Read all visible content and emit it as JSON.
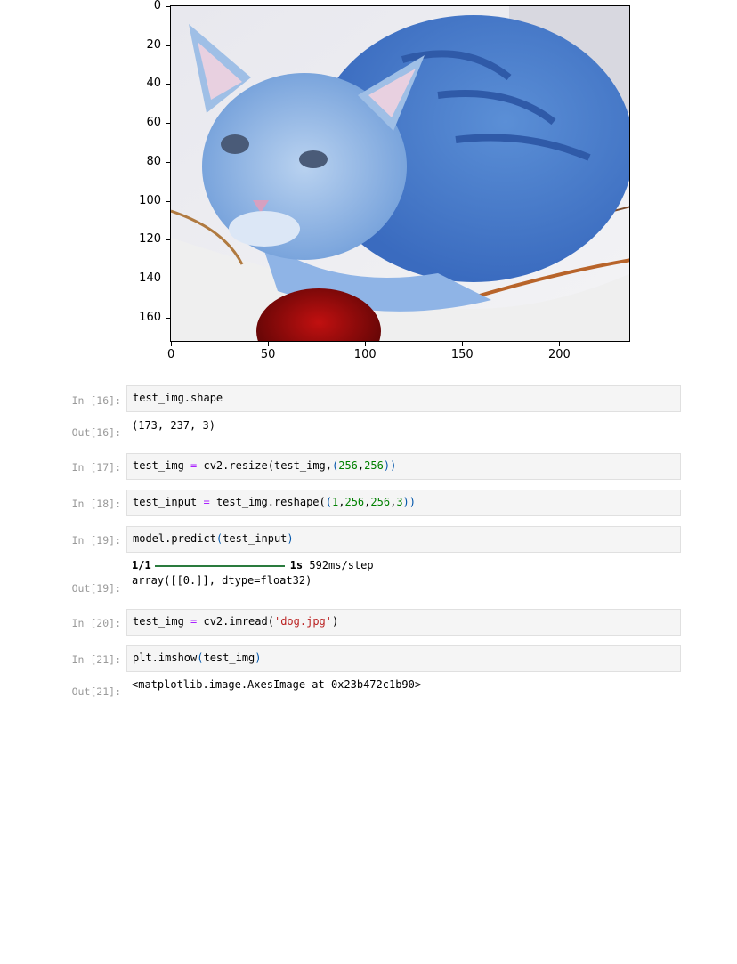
{
  "plot": {
    "y_ticks": [
      "0",
      "20",
      "40",
      "60",
      "80",
      "100",
      "120",
      "140",
      "160"
    ],
    "x_ticks": [
      "0",
      "50",
      "100",
      "150",
      "200"
    ],
    "image_shape": [
      173,
      237,
      3
    ],
    "image_subject": "blue-tinted cat"
  },
  "cells": [
    {
      "in_prompt": "In [16]:",
      "code": "test_img.shape",
      "out_prompt": "Out[16]:",
      "output": "(173, 237, 3)"
    },
    {
      "in_prompt": "In [17]:",
      "code_parts": [
        "test_img",
        " = ",
        "cv2.resize(",
        "test_img,",
        "(",
        "256",
        ",",
        "256",
        "))"
      ]
    },
    {
      "in_prompt": "In [18]:",
      "code_parts": [
        "test_input",
        " = ",
        "test_img.reshape(",
        "(",
        "1",
        ",",
        "256",
        ",",
        "256",
        ",",
        "3",
        "))"
      ]
    },
    {
      "in_prompt": "In [19]:",
      "code_parts": [
        "model.predict",
        "(",
        "test_input",
        ")"
      ],
      "out_prompt": "Out[19]:",
      "progress_step": "1/1",
      "progress_time": "1s",
      "progress_rate": "592ms/step",
      "output": "array([[0.]], dtype=float32)"
    },
    {
      "in_prompt": "In [20]:",
      "code_parts": [
        "test_img",
        " = ",
        "cv2.imread(",
        "'dog.jpg'",
        ")"
      ]
    },
    {
      "in_prompt": "In [21]:",
      "code_parts": [
        "plt.imshow",
        "(",
        "test_img",
        ")"
      ],
      "out_prompt": "Out[21]:",
      "output": "<matplotlib.image.AxesImage at 0x23b472c1b90>"
    }
  ]
}
